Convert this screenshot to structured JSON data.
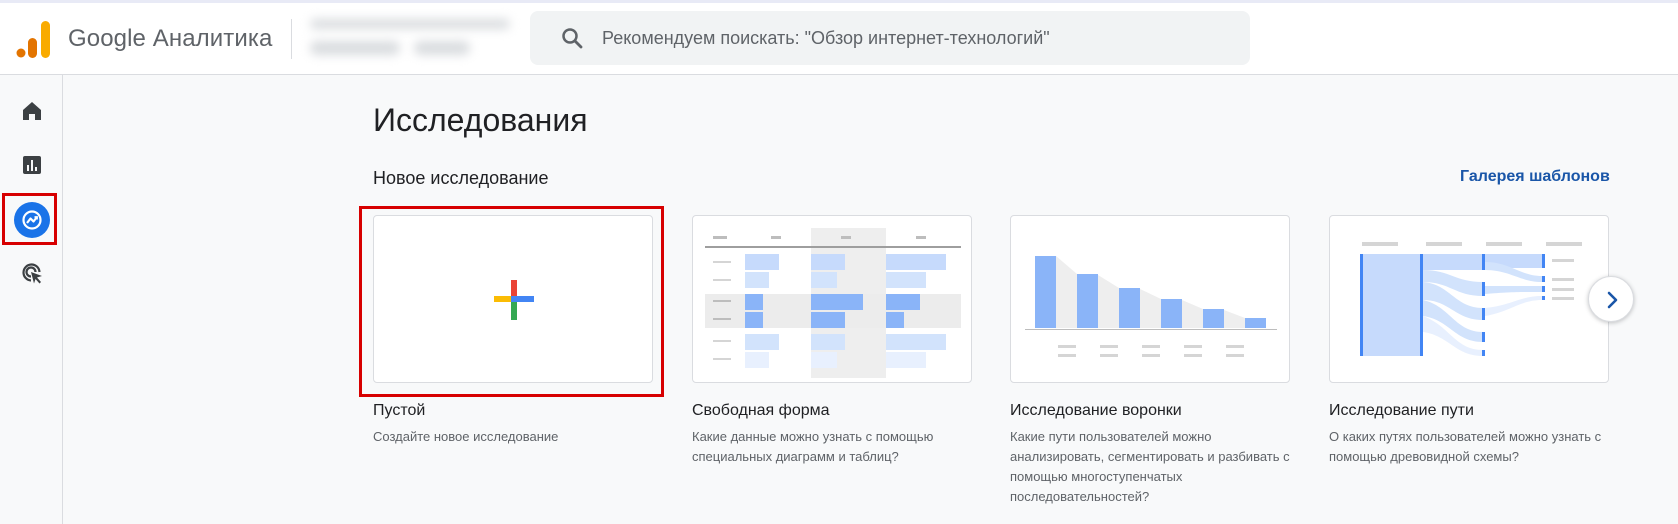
{
  "header": {
    "brand": "Google Аналитика",
    "search_placeholder": "Рекомендуем поискать: \"Обзор интернет-технологий\""
  },
  "sidebar": {
    "items": [
      {
        "name": "home-icon"
      },
      {
        "name": "reports-icon"
      },
      {
        "name": "explore-icon",
        "active": true
      },
      {
        "name": "advertising-icon"
      }
    ]
  },
  "main": {
    "title": "Исследования",
    "section_title": "Новое исследование",
    "gallery_link": "Галерея шаблонов",
    "cards": [
      {
        "title": "Пустой",
        "desc": "Создайте новое исследование"
      },
      {
        "title": "Свободная форма",
        "desc": "Какие данные можно узнать с помощью специальных диаграмм и таблиц?"
      },
      {
        "title": "Исследование воронки",
        "desc": "Какие пути пользователей можно анализировать, сегментировать и разбивать с помощью многоступенчатых последовательностей?"
      },
      {
        "title": "Исследование пути",
        "desc": "О каких путях пользователей можно узнать с помощью древовидной схемы?"
      }
    ]
  },
  "colors": {
    "accent": "#1a73e8",
    "highlight": "#d70000",
    "preview_blue": "#8ab4f8"
  }
}
